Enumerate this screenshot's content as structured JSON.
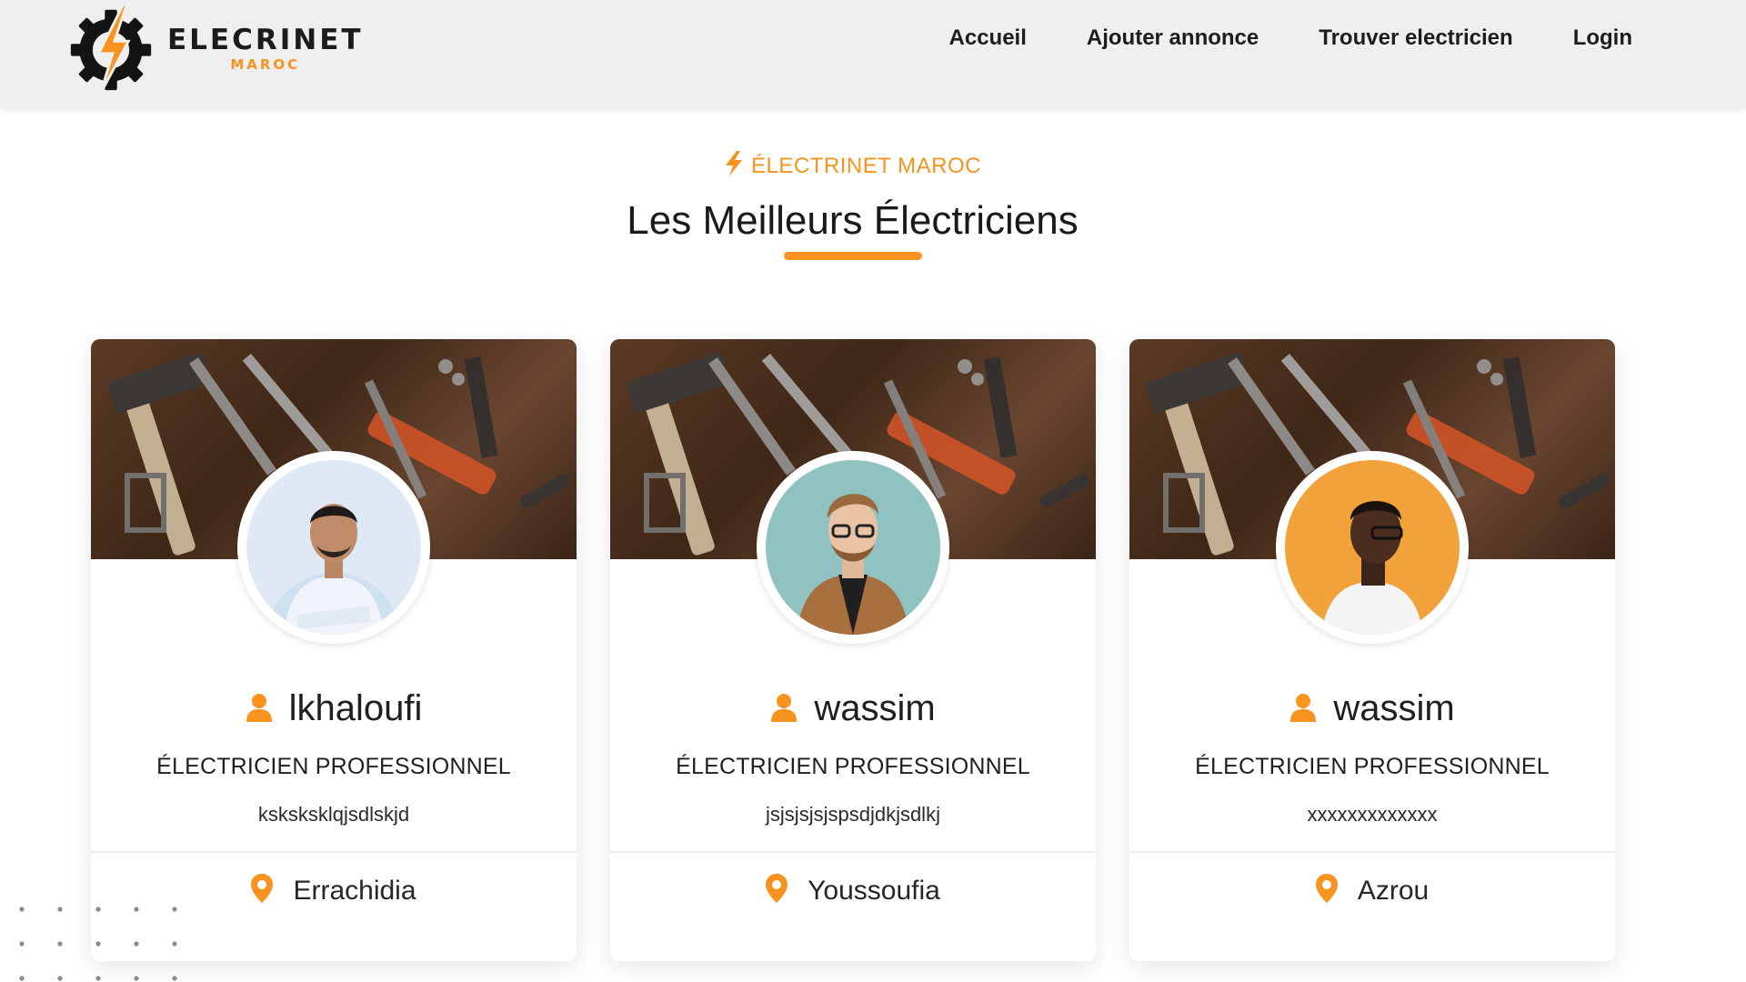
{
  "brand": {
    "name": "ELECRINET",
    "sub": "MAROC"
  },
  "nav": [
    {
      "label": "Accueil"
    },
    {
      "label": "Ajouter annonce"
    },
    {
      "label": "Trouver electricien"
    },
    {
      "label": "Login"
    }
  ],
  "section": {
    "eyebrow": "ÉLECTRINET MAROC",
    "title": "Les Meilleurs Électriciens"
  },
  "cards": [
    {
      "name": "lkhaloufi",
      "role": "ÉLECTRICIEN PROFESSIONNEL",
      "description": "ksksksklqjsdlskjd",
      "city": "Errachidia",
      "avatar_bg": "#dfe9f6"
    },
    {
      "name": "wassim",
      "role": "ÉLECTRICIEN PROFESSIONNEL",
      "description": "jsjsjsjsjspsdjdkjsdlkj",
      "city": "Youssoufia",
      "avatar_bg": "#8fc2c0"
    },
    {
      "name": "wassim",
      "role": "ÉLECTRICIEN PROFESSIONNEL",
      "description": "xxxxxxxxxxxxx",
      "city": "Azrou",
      "avatar_bg": "#f2a23a"
    }
  ],
  "colors": {
    "accent": "#f7931e",
    "header_bg": "#eeefee",
    "text": "#1f1f1f"
  },
  "icons": [
    "gear-bolt-logo-icon",
    "bolt-icon",
    "user-icon",
    "location-pin-icon"
  ]
}
